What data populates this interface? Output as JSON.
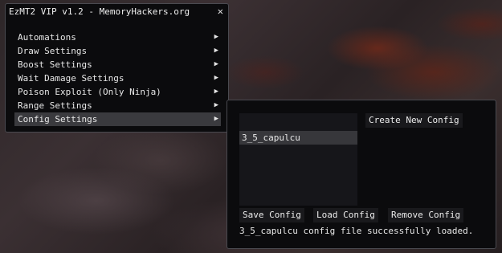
{
  "main_window": {
    "title": "EzMT2 VIP v1.2 - MemoryHackers.org",
    "close_glyph": "✕",
    "arrow_glyph": "▶",
    "menu_items": [
      {
        "label": "Automations"
      },
      {
        "label": "Draw Settings"
      },
      {
        "label": "Boost Settings"
      },
      {
        "label": "Wait Damage Settings"
      },
      {
        "label": "Poison Exploit (Only Ninja)"
      },
      {
        "label": "Range Settings"
      },
      {
        "label": "Config Settings",
        "selected": true
      }
    ]
  },
  "config_window": {
    "create_label": "Create New Config",
    "configs": [
      "3_5_capulcu"
    ],
    "save_label": "Save Config",
    "load_label": "Load Config",
    "remove_label": "Remove Config",
    "status": "3_5_capulcu config file successfully loaded."
  },
  "colors": {
    "window_bg": "#0b0b0d",
    "border": "#4a4a50",
    "selected_bg": "#3a3a3e",
    "list_bg": "#16161a",
    "text": "#e8e8e8"
  }
}
